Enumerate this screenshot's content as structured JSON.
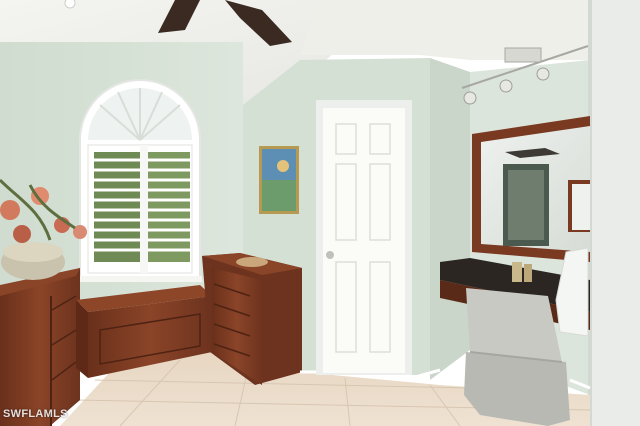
{
  "photo": {
    "subject": "bathroom-vanity-room-interior",
    "watermark": "SWFLAMLS"
  },
  "colors": {
    "wall": "#d9e3d9",
    "ceiling": "#f2f2ee",
    "wood": "#7a3a22",
    "floor": "#e8d8c4",
    "door": "#fbfbf8",
    "granite": "#2b2622"
  }
}
